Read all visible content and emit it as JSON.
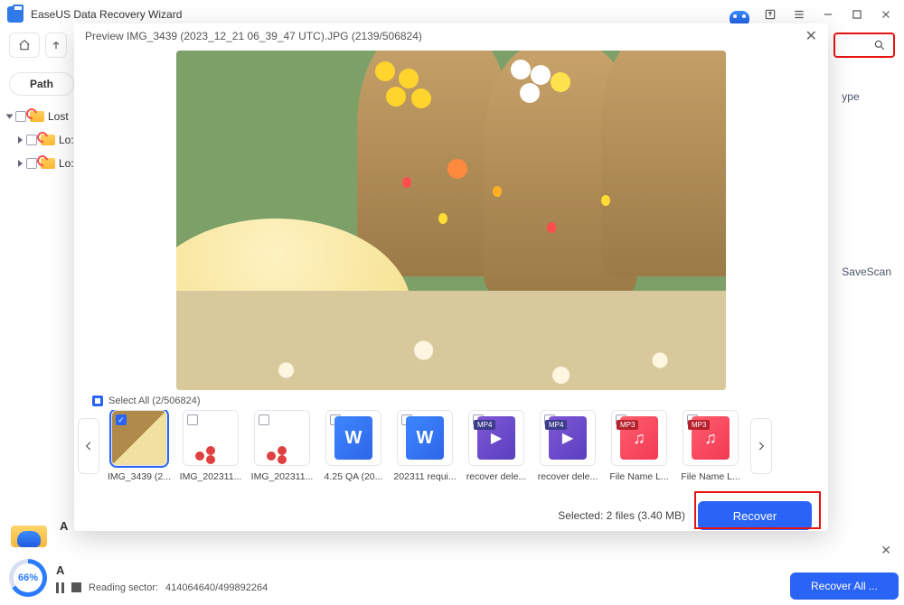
{
  "app": {
    "title": "EaseUS Data Recovery Wizard"
  },
  "toolbar": {
    "path_label": "Path",
    "type_label": "ype",
    "savescan_label": "SaveScan"
  },
  "search": {
    "placeholder": ""
  },
  "tree": {
    "root": "Lost",
    "children": [
      "Lo:",
      "Lo:"
    ]
  },
  "status": {
    "letter_top": "A",
    "letter_mid": "A",
    "progress_pct": "66%",
    "reading_label": "Reading sector:",
    "reading_values": "414064640/499892264",
    "recover_all": "Recover All ..."
  },
  "preview": {
    "title": "Preview IMG_3439 (2023_12_21 06_39_47 UTC).JPG (2139/506824)",
    "select_all_label": "Select All (2/506824)",
    "selected_label": "Selected: 2 files (3.40 MB)",
    "recover_label": "Recover",
    "thumbs": [
      {
        "label": "IMG_3439 (2...",
        "type": "img1",
        "selected": true
      },
      {
        "label": "IMG_202311...",
        "type": "img2",
        "selected": false
      },
      {
        "label": "IMG_202311...",
        "type": "img2",
        "selected": false
      },
      {
        "label": "4.25 QA (20...",
        "type": "doc",
        "selected": false,
        "badge": ""
      },
      {
        "label": "202311 requi...",
        "type": "doc",
        "selected": false,
        "badge": ""
      },
      {
        "label": "recover dele...",
        "type": "mp4",
        "selected": false,
        "badge": "MP4"
      },
      {
        "label": "recover dele...",
        "type": "mp4",
        "selected": false,
        "badge": "MP4"
      },
      {
        "label": "File Name L...",
        "type": "mp3",
        "selected": false,
        "badge": "MP3"
      },
      {
        "label": "File Name L...",
        "type": "mp3",
        "selected": false,
        "badge": "MP3"
      }
    ]
  },
  "colors": {
    "brand_blue": "#2a64f6",
    "highlight_red": "#e81212"
  }
}
